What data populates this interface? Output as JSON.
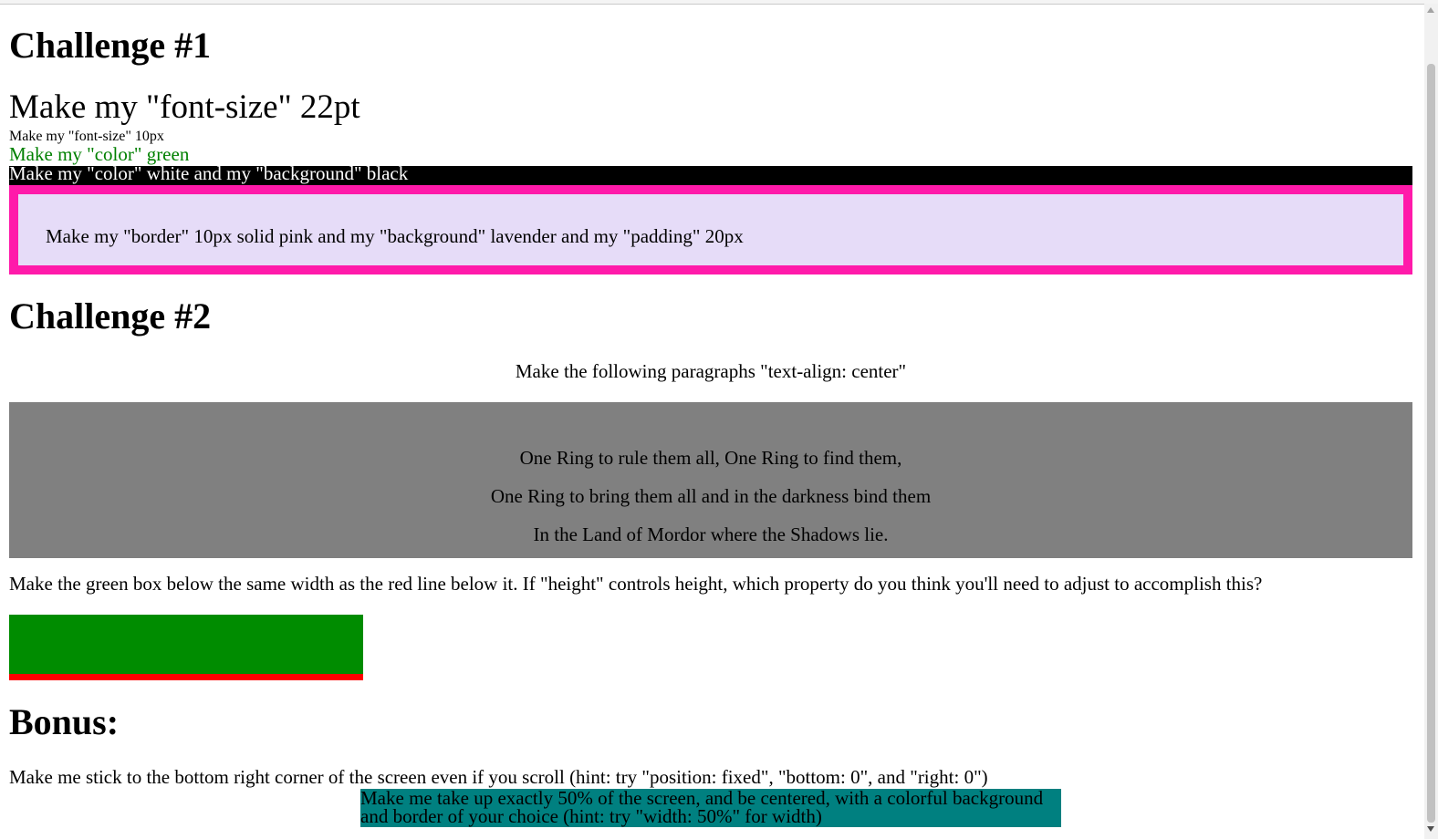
{
  "challenge1": {
    "heading": "Challenge #1",
    "font_size_22pt": "Make my \"font-size\" 22pt",
    "font_size_10px": "Make my \"font-size\" 10px",
    "color_green": "Make my \"color\" green",
    "white_on_black": "Make my \"color\" white and my \"background\" black",
    "border_box": "Make my \"border\" 10px solid pink and my \"background\" lavender and my \"padding\" 20px"
  },
  "challenge2": {
    "heading": "Challenge #2",
    "center_instruction": "Make the following paragraphs \"text-align: center\"",
    "ring_lines": [
      "One Ring to rule them all, One Ring to find them,",
      "One Ring to bring them all and in the darkness bind them",
      "In the Land of Mordor where the Shadows lie."
    ],
    "width_instruction": "Make the green box below the same width as the red line below it. If \"height\" controls height, which property do you think you'll need to adjust to accomplish this?"
  },
  "bonus": {
    "heading": "Bonus:",
    "stick_instruction": "Make me stick to the bottom right corner of the screen even if you scroll (hint: try \"position: fixed\", \"bottom: 0\", and \"right: 0\")",
    "teal_box": "Make me take up exactly 50% of the screen, and be centered, with a colorful background and border of your choice (hint: try \"width: 50%\" for width)"
  },
  "colors": {
    "green_text": "#008000",
    "pink_border": "#ff1aaa",
    "lavender": "#e6dcf8",
    "grey_box": "#808080",
    "green_box": "#008c00",
    "red_line": "#ff0000",
    "teal_box": "#008080"
  }
}
